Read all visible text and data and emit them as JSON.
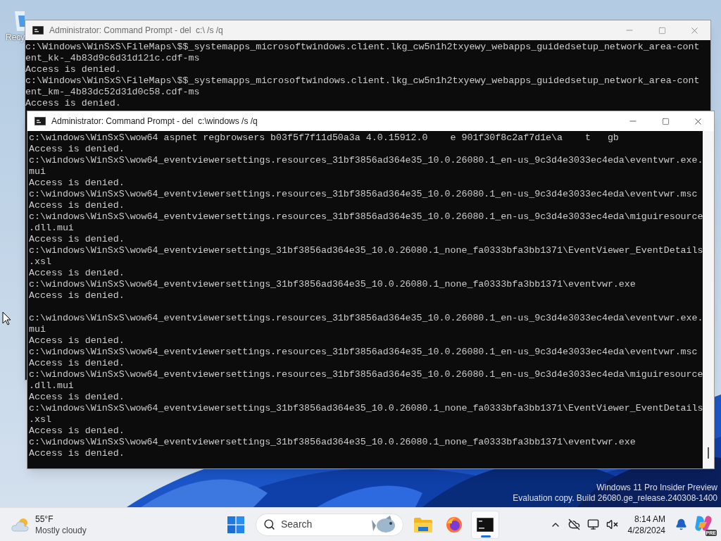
{
  "desktop": {
    "icon_label": "Recy",
    "watermark": [
      "Windows 11 Pro Insider Preview",
      "Evaluation copy. Build 26080.ge_release.240308-1400"
    ]
  },
  "windows": [
    {
      "title": "Administrator: Command Prompt - del  c:\\ /s /q",
      "active": false,
      "lines": [
        {
          "text": "c:\\Windows\\WinSxS\\FileMaps\\$$_systemapps_microsoftwindows.client.lkg_cw5n1h2txyewy_webapps_guidedsetup_network_area-cont"
        },
        {
          "text": "ent_kk-_4b83d9c6d31d121c.cdf-ms"
        },
        {
          "text": "Access is denied."
        },
        {
          "text": "c:\\Windows\\WinSxS\\FileMaps\\$$_systemapps_microsoftwindows.client.lkg_cw5n1h2txyewy_webapps_guidedsetup_network_area-cont"
        },
        {
          "text": "ent_km-_4b83dc52d31d0c58.cdf-ms"
        },
        {
          "text": "Access is denied."
        }
      ]
    },
    {
      "title": "Administrator: Command Prompt - del  c:\\windows /s /q",
      "active": true,
      "lines": [
        {
          "text": "c:\\windows\\WinSxS\\wow64 aspnet regbrowsers b03f5f7f11d50a3a 4.0.15912.0    e 901f30f8c2af7d1e\\a    t   gb"
        },
        {
          "text": "Access is denied."
        },
        {
          "text": "c:\\windows\\WinSxS\\wow64_eventviewersettings.resources_31bf3856ad364e35_10.0.26080.1_en-us_9c3d4e3033ec4eda\\eventvwr.exe."
        },
        {
          "text": "mui"
        },
        {
          "text": "Access is denied."
        },
        {
          "text": "c:\\windows\\WinSxS\\wow64_eventviewersettings.resources_31bf3856ad364e35_10.0.26080.1_en-us_9c3d4e3033ec4eda\\eventvwr.msc"
        },
        {
          "text": "Access is denied."
        },
        {
          "text": "c:\\windows\\WinSxS\\wow64_eventviewersettings.resources_31bf3856ad364e35_10.0.26080.1_en-us_9c3d4e3033ec4eda\\miguiresource"
        },
        {
          "text": ".dll.mui"
        },
        {
          "text": "Access is denied."
        },
        {
          "text": "c:\\windows\\WinSxS\\wow64_eventviewersettings_31bf3856ad364e35_10.0.26080.1_none_fa0333bfa3bb1371\\EventViewer_EventDetails"
        },
        {
          "text": ".xsl"
        },
        {
          "text": "Access is denied."
        },
        {
          "text": "c:\\windows\\WinSxS\\wow64_eventviewersettings_31bf3856ad364e35_10.0.26080.1_none_fa0333bfa3bb1371\\eventvwr.exe"
        },
        {
          "text": "Access is denied."
        },
        {
          "kind": "blank"
        },
        {
          "text": "c:\\windows\\WinSxS\\wow64_eventviewersettings.resources_31bf3856ad364e35_10.0.26080.1_en-us_9c3d4e3033ec4eda\\eventvwr.exe."
        },
        {
          "text": "mui"
        },
        {
          "text": "Access is denied."
        },
        {
          "text": "c:\\windows\\WinSxS\\wow64_eventviewersettings.resources_31bf3856ad364e35_10.0.26080.1_en-us_9c3d4e3033ec4eda\\eventvwr.msc"
        },
        {
          "text": "Access is denied."
        },
        {
          "text": "c:\\windows\\WinSxS\\wow64_eventviewersettings.resources_31bf3856ad364e35_10.0.26080.1_en-us_9c3d4e3033ec4eda\\miguiresource"
        },
        {
          "text": ".dll.mui"
        },
        {
          "text": "Access is denied."
        },
        {
          "text": "c:\\windows\\WinSxS\\wow64_eventviewersettings_31bf3856ad364e35_10.0.26080.1_none_fa0333bfa3bb1371\\EventViewer_EventDetails"
        },
        {
          "text": ".xsl"
        },
        {
          "text": "Access is denied."
        },
        {
          "text": "c:\\windows\\WinSxS\\wow64_eventviewersettings_31bf3856ad364e35_10.0.26080.1_none_fa0333bfa3bb1371\\eventvwr.exe"
        },
        {
          "text": "Access is denied."
        }
      ]
    }
  ],
  "taskbar": {
    "weather": {
      "temperature": "55°F",
      "condition": "Mostly cloudy"
    },
    "search": {
      "placeholder": "Search"
    },
    "apps": [
      {
        "kind": "start",
        "selected": false
      },
      {
        "kind": "search"
      },
      {
        "kind": "files",
        "selected": false
      },
      {
        "kind": "browser",
        "selected": false
      },
      {
        "kind": "terminal",
        "selected": true
      }
    ],
    "clock": {
      "time": "8:14 AM",
      "date": "4/28/2024"
    },
    "copilot_badge": "PRE"
  }
}
